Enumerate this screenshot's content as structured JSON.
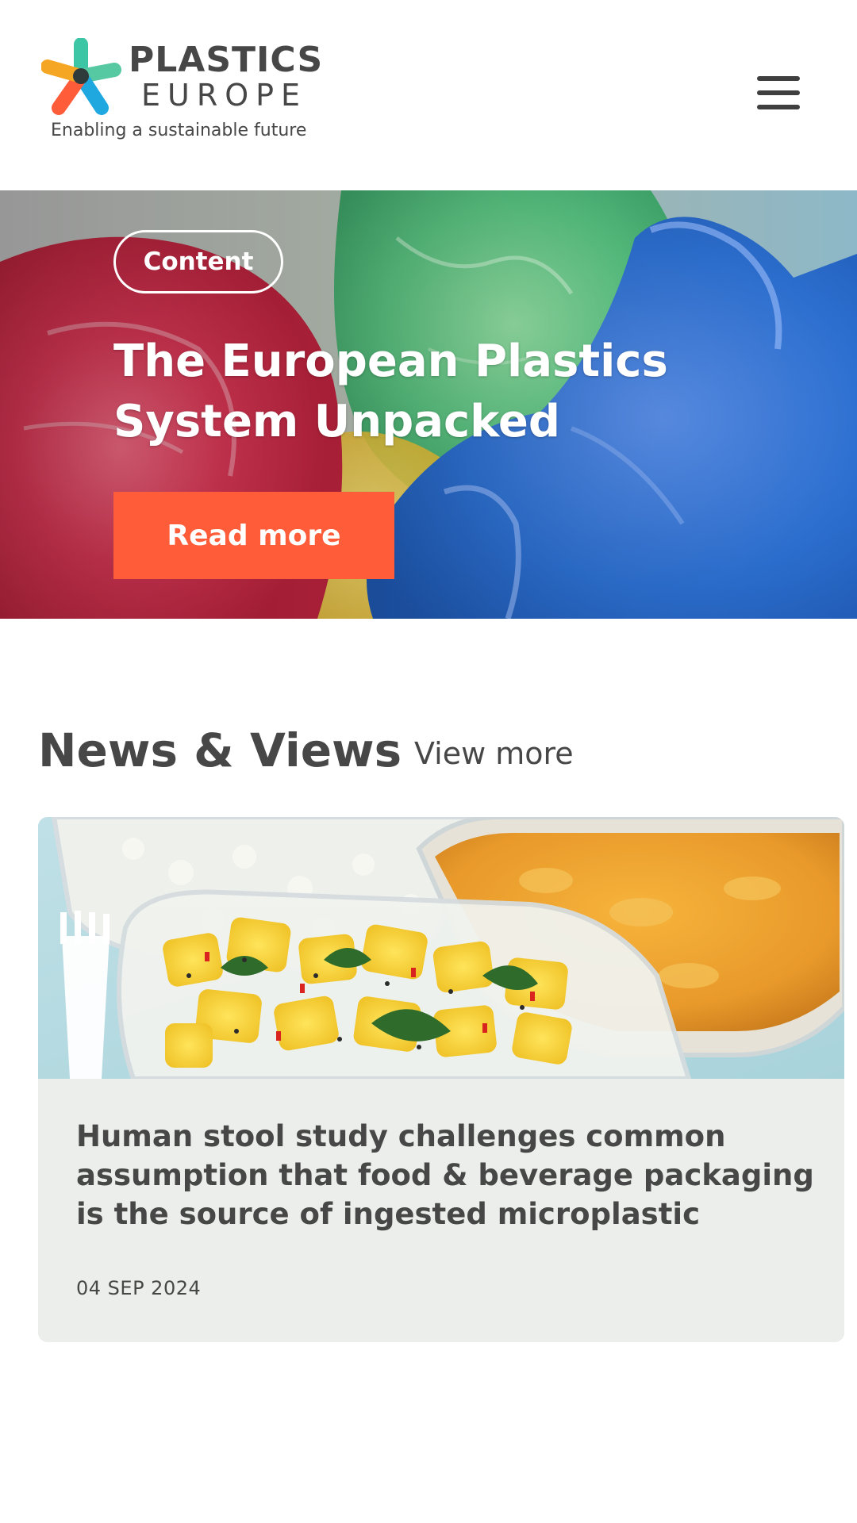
{
  "brand": {
    "name_line1": "PLASTICS",
    "name_line2": "EUROPE",
    "tagline": "Enabling a sustainable future",
    "colors": {
      "mark_teal": "#3cc6a6",
      "mark_green": "#56c8a2",
      "mark_orange": "#f5a623",
      "mark_red": "#ff5c39",
      "mark_blue": "#1fa8e0",
      "mark_center": "#2f3a3a"
    }
  },
  "header": {
    "menu_icon": "hamburger-menu-icon"
  },
  "hero": {
    "tag_label": "Content",
    "title": "The European Plastics System Unpacked",
    "cta_label": "Read more",
    "cta_color": "#ff5c39",
    "image_subject": "colored plastic bags"
  },
  "news": {
    "heading": "News & Views",
    "view_more_label": "View more",
    "items": [
      {
        "title": "Human stool study challenges common assumption that food & beverage packaging is the source of ingested microplastic",
        "date": "04 SEP 2024",
        "image_subject": "food in plastic takeaway containers"
      }
    ]
  }
}
